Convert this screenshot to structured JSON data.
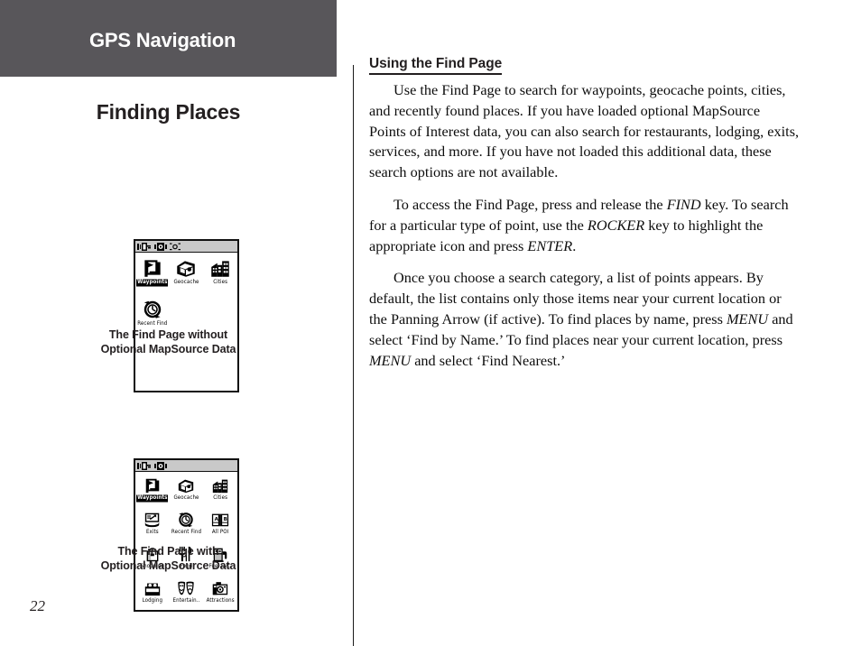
{
  "header": {
    "title": "GPS Navigation",
    "background_color": "#58565a",
    "text_color": "#ffffff"
  },
  "left_column": {
    "section_title": "Finding Places",
    "page_number": "22",
    "figures": [
      {
        "id": "find-page-without-mapsource",
        "caption_line_1": "The Find Page without",
        "caption_line_2": "Optional MapSource Data",
        "status_icons": [
          "battery-plug-icon",
          "satellite-icon",
          "backlight-icon"
        ],
        "grid_columns": 3,
        "items": [
          {
            "label": "Waypoints",
            "icon": "waypoints-flag-icon",
            "selected": true
          },
          {
            "label": "Geocache",
            "icon": "geocache-box-icon",
            "selected": false
          },
          {
            "label": "Cities",
            "icon": "cities-buildings-icon",
            "selected": false
          },
          {
            "label": "Recent Find",
            "icon": "recent-find-clock-icon",
            "selected": false
          }
        ]
      },
      {
        "id": "find-page-with-mapsource",
        "caption_line_1": "The Find Page with",
        "caption_line_2": "Optional MapSource Data",
        "status_icons": [
          "battery-plug-icon",
          "satellite-icon"
        ],
        "grid_columns": 3,
        "items": [
          {
            "label": "Waypoints",
            "icon": "waypoints-flag-icon",
            "selected": true
          },
          {
            "label": "Geocache",
            "icon": "geocache-box-icon",
            "selected": false
          },
          {
            "label": "Cities",
            "icon": "cities-buildings-icon",
            "selected": false
          },
          {
            "label": "Exits",
            "icon": "exits-sign-icon",
            "selected": false
          },
          {
            "label": "Recent Find",
            "icon": "recent-find-clock-icon",
            "selected": false
          },
          {
            "label": "All POI",
            "icon": "all-poi-book-icon",
            "selected": false
          },
          {
            "label": "Shopping",
            "icon": "shopping-bag-icon",
            "selected": false
          },
          {
            "label": "Food",
            "icon": "food-fork-knife-icon",
            "selected": false
          },
          {
            "label": "Fuel Svc.",
            "icon": "fuel-pump-icon",
            "selected": false
          },
          {
            "label": "Lodging",
            "icon": "lodging-bed-icon",
            "selected": false
          },
          {
            "label": "Entertain..",
            "icon": "entertainment-masks-icon",
            "selected": false
          },
          {
            "label": "Attractions",
            "icon": "attractions-camera-icon",
            "selected": false
          }
        ]
      }
    ]
  },
  "right_column": {
    "heading": "Using the Find Page",
    "paragraphs": [
      {
        "runs": [
          {
            "text": "Use the Find Page to search for waypoints, geocache points, cities, and recently found places. If you have loaded optional MapSource Points of Interest data, you can also search for restaurants, lodging, exits, services, and more. If you have not loaded this additional data, these search options are not available.",
            "style": "normal"
          }
        ]
      },
      {
        "runs": [
          {
            "text": "To access the Find Page, press and release the ",
            "style": "normal"
          },
          {
            "text": "FIND",
            "style": "italic"
          },
          {
            "text": " key. To search for a particular type of point, use the ",
            "style": "normal"
          },
          {
            "text": "ROCKER",
            "style": "italic"
          },
          {
            "text": " key to highlight the appropriate icon and press ",
            "style": "normal"
          },
          {
            "text": "ENTER",
            "style": "italic"
          },
          {
            "text": ".",
            "style": "normal"
          }
        ]
      },
      {
        "runs": [
          {
            "text": "Once you choose a search category, a list of points appears. By default, the list contains only those items near your current location or the Panning Arrow (if active). To find places by name, press ",
            "style": "normal"
          },
          {
            "text": "MENU",
            "style": "italic"
          },
          {
            "text": " and select ‘Find by Name.’ To find places near your current location, press ",
            "style": "normal"
          },
          {
            "text": "MENU",
            "style": "italic"
          },
          {
            "text": " and select ‘Find Nearest.’",
            "style": "normal"
          }
        ]
      }
    ]
  }
}
